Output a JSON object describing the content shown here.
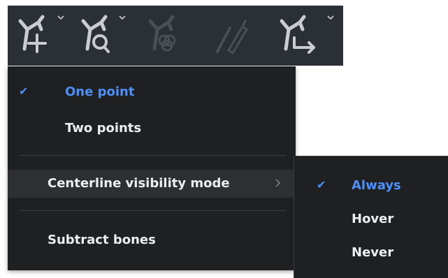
{
  "toolbar": {
    "tools": [
      {
        "icon": "vessel-add-point-icon",
        "has_dropdown": true,
        "enabled": true
      },
      {
        "icon": "vessel-zoom-icon",
        "has_dropdown": true,
        "enabled": true
      },
      {
        "icon": "vessel-segment-icon",
        "has_dropdown": false,
        "enabled": false
      },
      {
        "icon": "centerline-edit-icon",
        "has_dropdown": false,
        "enabled": false
      },
      {
        "icon": "vessel-export-icon",
        "has_dropdown": true,
        "enabled": true
      }
    ]
  },
  "menu": {
    "items": [
      {
        "label": "One point",
        "checked": true
      },
      {
        "label": "Two points",
        "checked": false
      },
      {
        "label": "Centerline visibility mode",
        "has_submenu": true
      },
      {
        "label": "Subtract bones"
      }
    ]
  },
  "submenu": {
    "items": [
      {
        "label": "Always",
        "checked": true
      },
      {
        "label": "Hover",
        "checked": false
      },
      {
        "label": "Never",
        "checked": false
      }
    ]
  },
  "colors": {
    "toolbar_bg": "#2b2f36",
    "menu_bg": "#1f2022",
    "accent": "#4f8ff7",
    "text": "#eceff1",
    "icon_enabled": "#c9ccd1",
    "icon_disabled": "#4a4e55"
  }
}
